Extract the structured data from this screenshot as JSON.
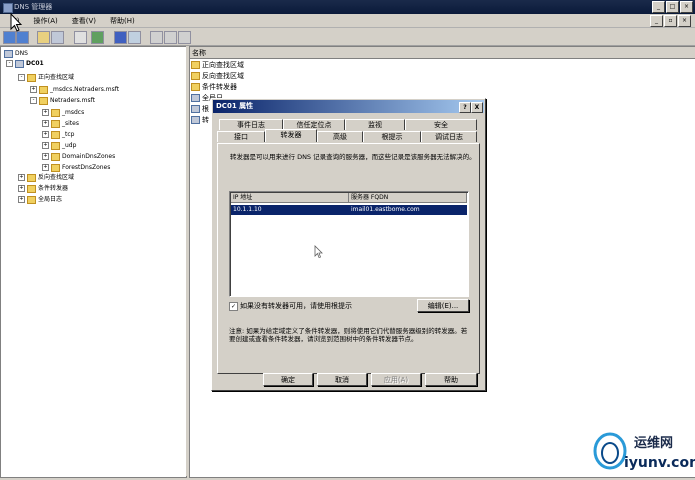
{
  "window": {
    "title": "DNS 管理器"
  },
  "menubar": {
    "items": [
      "(F)",
      "操作(A)",
      "查看(V)",
      "帮助(H)"
    ]
  },
  "tree": {
    "root": "DNS",
    "server": "DC01",
    "items": [
      {
        "label": "正向查找区域",
        "level": 2,
        "exp": "-"
      },
      {
        "label": "_msdcs.Netraders.msft",
        "level": 3,
        "exp": "+"
      },
      {
        "label": "Netraders.msft",
        "level": 3,
        "exp": "-"
      },
      {
        "label": "_msdcs",
        "level": 4,
        "exp": "+"
      },
      {
        "label": "_sites",
        "level": 4,
        "exp": "+"
      },
      {
        "label": "_tcp",
        "level": 4,
        "exp": "+"
      },
      {
        "label": "_udp",
        "level": 4,
        "exp": "+"
      },
      {
        "label": "DomainDnsZones",
        "level": 4,
        "exp": "+"
      },
      {
        "label": "ForestDnsZones",
        "level": 4,
        "exp": "+"
      },
      {
        "label": "反向查找区域",
        "level": 2,
        "exp": "+"
      },
      {
        "label": "条件转发器",
        "level": 2,
        "exp": "+"
      },
      {
        "label": "全局日志",
        "level": 2,
        "exp": "+"
      }
    ]
  },
  "right_pane": {
    "column_header": "名称",
    "items": [
      "正向查找区域",
      "反向查找区域",
      "条件转发器",
      "全局日",
      "根",
      "转"
    ]
  },
  "dialog": {
    "title": "DC01 属性",
    "help_btn": "?",
    "close_btn": "X",
    "tabs_row1": [
      "事件日志",
      "信任定位点",
      "监视",
      "安全"
    ],
    "tabs_row2": [
      "接口",
      "转发器",
      "高级",
      "根提示",
      "调试日志"
    ],
    "active_tab": "转发器",
    "description": "转发器是可以用来进行 DNS 记录查询的服务器，而这些记录是该服务器无法解决的。",
    "list": {
      "col_ip": "IP 地址",
      "col_fqdn": "服务器 FQDN",
      "rows": [
        {
          "ip": "10.1.1.10",
          "fqdn": "imail01.eastbome.com"
        }
      ]
    },
    "use_root_hints_label": "如果没有转发器可用，请使用根提示",
    "use_root_hints_checked": true,
    "edit_button": "编辑(E)...",
    "note": "注意: 如果为给定域定义了条件转发器，则将使用它们代替服务器级别的转发器。若要创建或查看条件转发器，请浏览到范围树中的条件转发器节点。",
    "buttons": {
      "ok": "确定",
      "cancel": "取消",
      "apply": "应用(A)",
      "help": "帮助"
    }
  },
  "watermark": {
    "line1": "运维网",
    "line2": "iyunv.com"
  }
}
